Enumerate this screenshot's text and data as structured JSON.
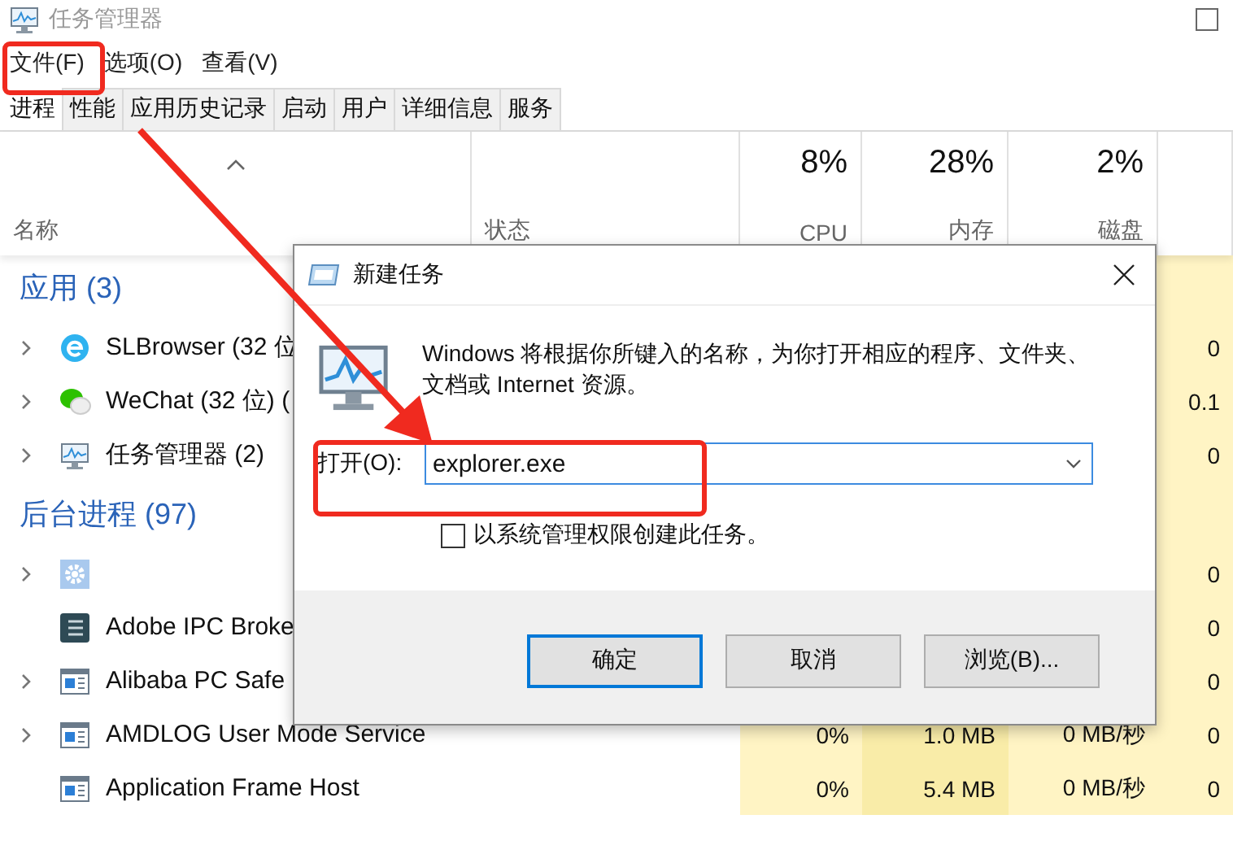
{
  "window": {
    "title": "任务管理器"
  },
  "menu": [
    "文件(F)",
    "选项(O)",
    "查看(V)"
  ],
  "tabs": [
    {
      "label": "进程",
      "selected": true
    },
    {
      "label": "性能",
      "selected": false
    },
    {
      "label": "应用历史记录",
      "selected": false
    },
    {
      "label": "启动",
      "selected": false
    },
    {
      "label": "用户",
      "selected": false
    },
    {
      "label": "详细信息",
      "selected": false
    },
    {
      "label": "服务",
      "selected": false
    }
  ],
  "columns": [
    {
      "label": "名称"
    },
    {
      "label": "状态"
    },
    {
      "usage": "8%",
      "label": "CPU"
    },
    {
      "usage": "28%",
      "label": "内存"
    },
    {
      "usage": "2%",
      "label": "磁盘"
    }
  ],
  "rows": [
    {
      "kind": "group",
      "label": "应用 (3)"
    },
    {
      "kind": "process",
      "name": "SLBrowser (32 位",
      "expandable": true,
      "column_6": "0"
    },
    {
      "kind": "process",
      "name": "WeChat (32 位) (",
      "expandable": true,
      "column_6": "0.1"
    },
    {
      "kind": "process",
      "name": "任务管理器 (2)",
      "expandable": true,
      "column_6": "0"
    },
    {
      "kind": "group",
      "label": "后台进程 (97)"
    },
    {
      "kind": "process",
      "expandable": true,
      "column_6": "0"
    },
    {
      "kind": "process",
      "name": "Adobe IPC Broke",
      "expandable": false,
      "column_6": "0"
    },
    {
      "kind": "process",
      "name": "Alibaba PC Safe",
      "expandable": true,
      "column_6": "0"
    },
    {
      "kind": "process",
      "name": "AMDLOG User Mode Service",
      "expandable": true,
      "cpu": "0%",
      "memory": "1.0 MB",
      "disk": "0 MB/秒",
      "column_6": "0"
    },
    {
      "kind": "process",
      "name": "Application Frame Host",
      "expandable": false,
      "cpu": "0%",
      "memory": "5.4 MB",
      "disk": "0 MB/秒",
      "column_6": "0"
    }
  ],
  "dialog": {
    "title": "新建任务",
    "message": "Windows 将根据你所键入的名称，为你打开相应的程序、文件夹、文档或 Internet 资源。",
    "open_label": "打开(O):",
    "open_value": "explorer.exe",
    "checkbox": {
      "label": "以系统管理权限创建此任务。",
      "checked": false
    },
    "buttons": [
      {
        "label": "确定",
        "default": true
      },
      {
        "label": "取消",
        "default": false
      },
      {
        "label": "浏览(B)...",
        "default": false
      }
    ]
  }
}
